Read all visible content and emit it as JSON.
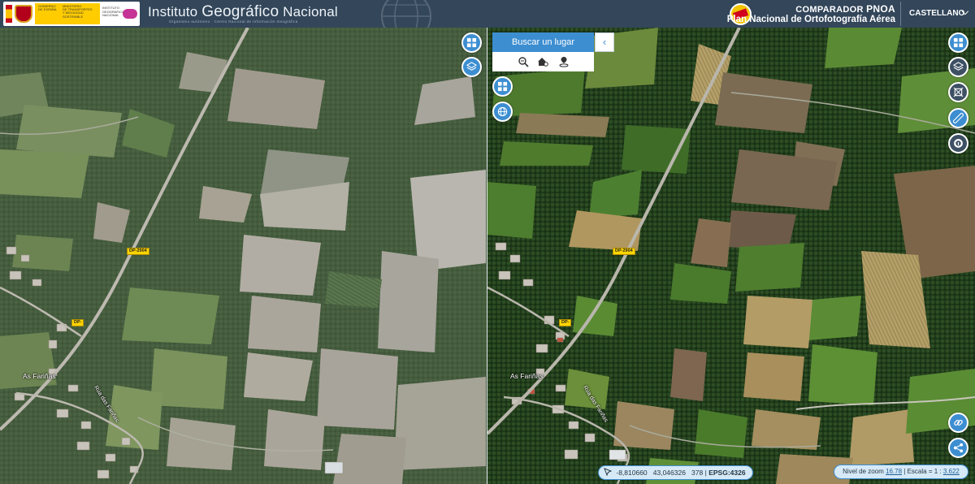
{
  "header": {
    "gov_ministry_lines": [
      "GOBIERNO",
      "DE ESPAÑA",
      "MINISTERIO",
      "DE TRANSPORTES",
      "Y MOVILIDAD SOSTENIBLE"
    ],
    "gov_secondary_lines": [
      "INSTITUTO",
      "GEOGRÁFICO",
      "NACIONAL"
    ],
    "ign_title_part1": "Instituto ",
    "ign_title_part2": "Geográfico",
    "ign_title_part3": " Nacional",
    "ign_subtitle": "Organismo autónomo · Centro Nacional de Información Geográfica",
    "app_title_prefix": "COMPARADOR ",
    "app_title_bold": "PNOA",
    "app_subtitle": "Plan Nacional de Ortofotografía Aérea",
    "language": "CASTELLANO",
    "colors": {
      "bar": "#33465a",
      "accent": "#3d8ed1"
    }
  },
  "left_map": {
    "labels": {
      "village": "As Fariñas",
      "street": "Rúa das Fariñas"
    },
    "road_signs": {
      "main": "DP-2904",
      "short": "DP-"
    },
    "controls": [
      {
        "name": "compare-mode",
        "icon": "grid-icon"
      },
      {
        "name": "layers",
        "icon": "layers-icon"
      }
    ]
  },
  "right_map": {
    "labels": {
      "village": "As Fariñas",
      "street": "Rúa das Fariñas"
    },
    "road_signs": {
      "main": "DP-2904",
      "short": "DP-"
    },
    "search": {
      "button_label": "Buscar un lugar",
      "collapse_icon": "chevron-left-icon",
      "tools": [
        "zoom-search-icon",
        "house-search-icon",
        "location-pin-icon"
      ]
    },
    "controls_left": [
      {
        "name": "compare-mode",
        "icon": "grid-icon"
      },
      {
        "name": "globe",
        "icon": "globe-icon"
      }
    ],
    "controls_right": [
      {
        "name": "compare-mode",
        "icon": "grid-icon"
      },
      {
        "name": "layers",
        "icon": "layers-icon"
      },
      {
        "name": "extent",
        "icon": "crop-icon"
      },
      {
        "name": "measure",
        "icon": "ruler-icon"
      },
      {
        "name": "map-info",
        "icon": "info-globe-icon"
      },
      {
        "name": "link",
        "icon": "link-icon"
      },
      {
        "name": "share",
        "icon": "share-icon"
      }
    ]
  },
  "status": {
    "lon": "-8,810660",
    "lat": "43,046326",
    "elev": "378",
    "separator": "|",
    "epsg": "EPSG:4326",
    "zoom_label": "Nivel de zoom",
    "zoom_value": "16.78",
    "scale_label": "Escala = 1 :",
    "scale_value": "3.622"
  }
}
